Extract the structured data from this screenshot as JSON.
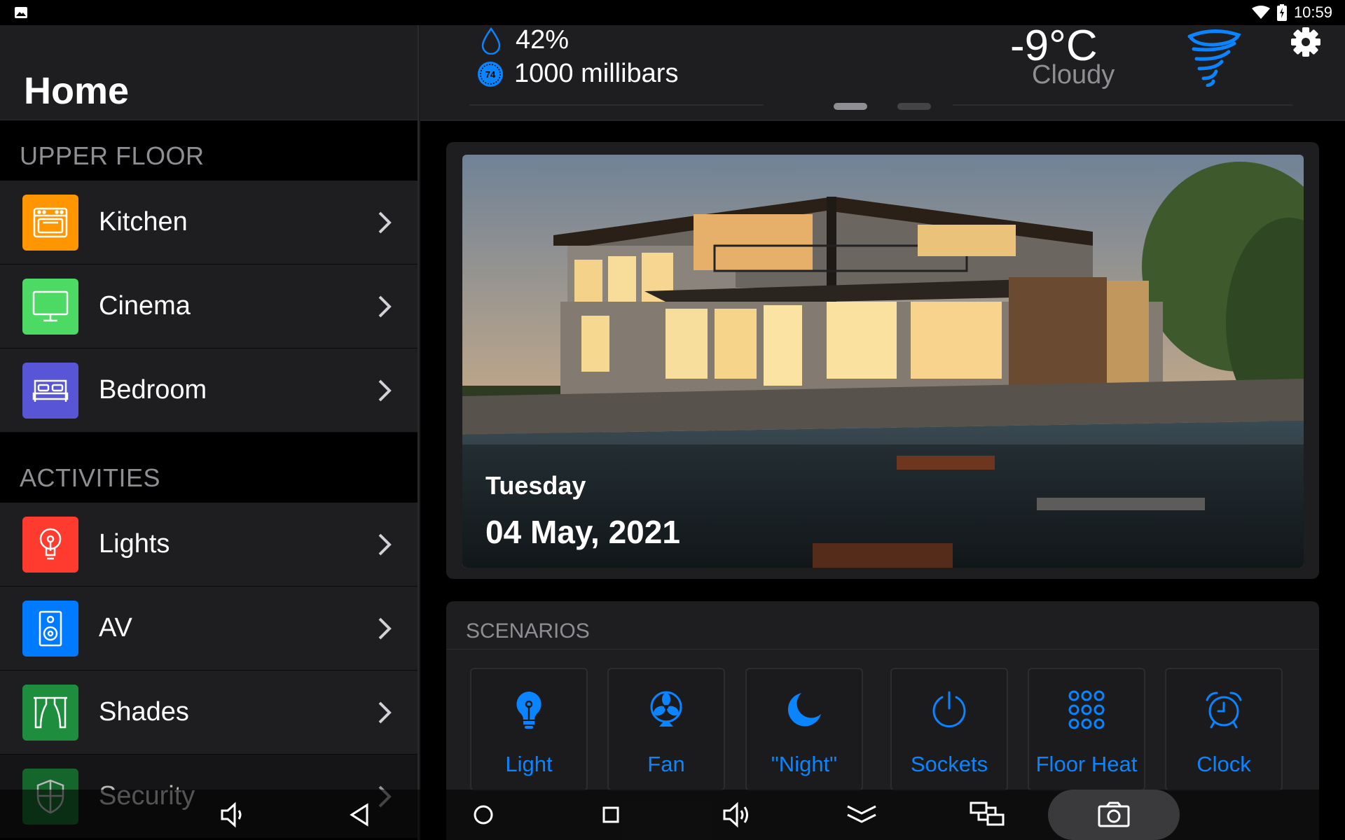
{
  "status": {
    "time": "10:59"
  },
  "sidebar": {
    "title": "Home",
    "sections": [
      {
        "heading": "UPPER FLOOR",
        "items": [
          {
            "label": "Kitchen",
            "color": "#ff9500",
            "icon": "oven-icon"
          },
          {
            "label": "Cinema",
            "color": "#4cd964",
            "icon": "monitor-icon"
          },
          {
            "label": "Bedroom",
            "color": "#5856d6",
            "icon": "bed-icon"
          }
        ]
      },
      {
        "heading": "ACTIVITIES",
        "items": [
          {
            "label": "Lights",
            "color": "#ff3b30",
            "icon": "bulb-icon"
          },
          {
            "label": "AV",
            "color": "#007aff",
            "icon": "speaker-icon"
          },
          {
            "label": "Shades",
            "color": "#1e8e3e",
            "icon": "curtains-icon"
          },
          {
            "label": "Security",
            "color": "#1e8e3e",
            "icon": "shield-icon"
          }
        ]
      }
    ]
  },
  "weather": {
    "humidity": "42%",
    "pressure_badge": "74",
    "pressure": "1000 millibars",
    "temperature": "-9°C",
    "condition": "Cloudy"
  },
  "banner": {
    "day": "Tuesday",
    "date": "04 May, 2021"
  },
  "scenarios": {
    "heading": "SCENARIOS",
    "items": [
      {
        "label": "Light",
        "icon": "lightbulb-icon"
      },
      {
        "label": "Fan",
        "icon": "fan-icon"
      },
      {
        "label": "\"Night\"",
        "icon": "moon-icon"
      },
      {
        "label": "Sockets",
        "icon": "power-icon"
      },
      {
        "label": "Floor Heat",
        "icon": "dots-grid-icon"
      },
      {
        "label": "Clock",
        "icon": "alarm-clock-icon"
      }
    ]
  },
  "colors": {
    "accent": "#0a84ff",
    "panel": "#1e1e20",
    "muted": "#8e8e93"
  }
}
